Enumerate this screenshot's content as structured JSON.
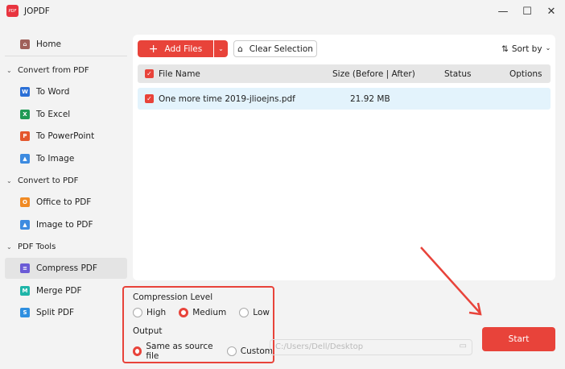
{
  "app": {
    "title": "JOPDF",
    "logo_text": "PDF"
  },
  "window": {
    "minimize": "—",
    "maximize": "☐",
    "close": "✕"
  },
  "sidebar": {
    "home": "Home",
    "groups": [
      {
        "label": "Convert from PDF",
        "items": [
          {
            "label": "To Word",
            "icon": "W",
            "color": "#2b6fd6"
          },
          {
            "label": "To Excel",
            "icon": "X",
            "color": "#1f9a55"
          },
          {
            "label": "To PowerPoint",
            "icon": "P",
            "color": "#e4572e"
          },
          {
            "label": "To Image",
            "icon": "▲",
            "color": "#3d8be0"
          }
        ]
      },
      {
        "label": "Convert to PDF",
        "items": [
          {
            "label": "Office to PDF",
            "icon": "O",
            "color": "#f08a24"
          },
          {
            "label": "Image to PDF",
            "icon": "▲",
            "color": "#3d8be0"
          }
        ]
      },
      {
        "label": "PDF Tools",
        "items": [
          {
            "label": "Compress PDF",
            "icon": "≡",
            "color": "#6b5bd6",
            "selected": true
          },
          {
            "label": "Merge PDF",
            "icon": "M",
            "color": "#1fb5a8"
          },
          {
            "label": "Split PDF",
            "icon": "S",
            "color": "#2f8fe0"
          }
        ]
      }
    ]
  },
  "toolbar": {
    "add_files": "Add Files",
    "clear_selection": "Clear Selection",
    "sort_by": "Sort by"
  },
  "table": {
    "headers": [
      "File Name",
      "Size (Before | After)",
      "Status",
      "Options"
    ],
    "rows": [
      {
        "name": "One more time 2019-jlioejns.pdf",
        "size": "21.92 MB",
        "status": "",
        "checked": true
      }
    ]
  },
  "options": {
    "compression_label": "Compression Level",
    "levels": [
      "High",
      "Medium",
      "Low"
    ],
    "selected_level": "Medium",
    "output_label": "Output",
    "outputs": [
      "Same as source file",
      "Custom"
    ],
    "selected_output": "Same as source file",
    "path": "C:/Users/Dell/Desktop"
  },
  "start": "Start",
  "accent": "#e8433a"
}
